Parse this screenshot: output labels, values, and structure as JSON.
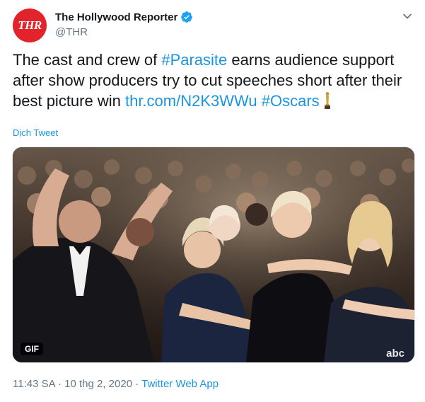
{
  "author": {
    "avatar_text": "THR",
    "display_name": "The Hollywood Reporter",
    "handle": "@THR"
  },
  "tweet": {
    "text_part1": "The cast and crew of ",
    "hashtag_parasite": "#Parasite",
    "text_part2": " earns audience support after show producers try to cut speeches short after their best picture win ",
    "url": "thr.com/N2K3WWu",
    "hashtag_oscars": "#Oscars",
    "translate_label": "Dịch Tweet"
  },
  "media": {
    "badge": "GIF",
    "watermark": "abc"
  },
  "meta": {
    "time": "11:43 SA",
    "separator1": " · ",
    "date": "10 thg 2, 2020",
    "separator2": " · ",
    "source": "Twitter Web App"
  },
  "colors": {
    "link": "#1b95e0",
    "verified": "#1da1f2",
    "avatar_bg": "#e3232b"
  },
  "icons": [
    "verified-badge-icon",
    "chevron-down-icon",
    "oscar-statue-icon"
  ]
}
